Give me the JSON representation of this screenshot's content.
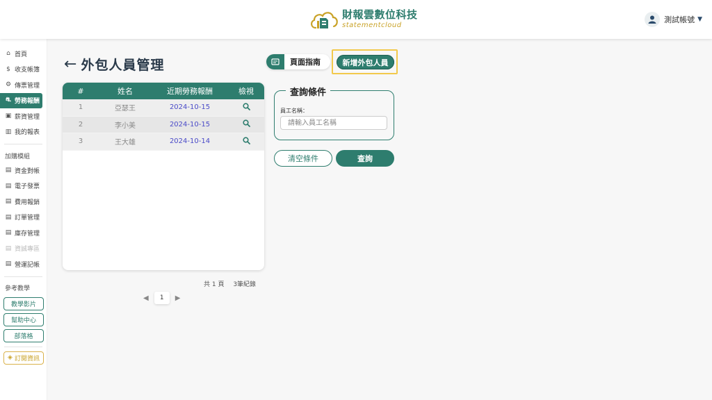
{
  "header": {
    "brand_cn": "財報雲數位科技",
    "brand_en": "statementcloud",
    "account_label": "測試帳號",
    "caret": "▼"
  },
  "sidebar": {
    "main_items": [
      {
        "label": "首頁",
        "icon": "home-icon",
        "glyph": "⌂"
      },
      {
        "label": "收支帳簿",
        "icon": "ledger-icon",
        "glyph": "$"
      },
      {
        "label": "傳票管理",
        "icon": "voucher-icon",
        "glyph": "⚙"
      },
      {
        "label": "勞務報酬",
        "icon": "labor-icon",
        "glyph": "⛐"
      },
      {
        "label": "薪資管理",
        "icon": "wallet-icon",
        "glyph": "▣"
      },
      {
        "label": "我的報表",
        "icon": "chart-icon",
        "glyph": "▥"
      }
    ],
    "addon_section_label": "加購模組",
    "addon_items": [
      {
        "label": "資金對帳",
        "icon": "doc-icon",
        "glyph": "▤"
      },
      {
        "label": "電子發票",
        "icon": "doc-icon",
        "glyph": "▤"
      },
      {
        "label": "費用報銷",
        "icon": "doc-icon",
        "glyph": "▤"
      },
      {
        "label": "訂單管理",
        "icon": "doc-icon",
        "glyph": "▤"
      },
      {
        "label": "庫存管理",
        "icon": "doc-icon",
        "glyph": "▤"
      },
      {
        "label": "資誠專區",
        "icon": "doc-icon",
        "glyph": "▤"
      },
      {
        "label": "營運記帳",
        "icon": "doc-icon",
        "glyph": "▤"
      }
    ],
    "reference_section_label": "參考教學",
    "reference_buttons": [
      "教學影片",
      "幫助中心",
      "部落格"
    ],
    "subscribe_label": "訂閱資訊",
    "subscribe_icon": "diamond-icon"
  },
  "page": {
    "back_arrow": "←",
    "title": "外包人員管理",
    "guide_label": "頁面指南",
    "guide_icon_glyph": "✉",
    "add_button_label": "新增外包人員"
  },
  "table": {
    "headers": [
      "#",
      "姓名",
      "近期勞務報酬",
      "檢視"
    ],
    "rows": [
      {
        "no": "1",
        "name": "亞瑟王",
        "date": "2024-10-15"
      },
      {
        "no": "2",
        "name": "李小美",
        "date": "2024-10-15"
      },
      {
        "no": "3",
        "name": "王大雄",
        "date": "2024-10-14"
      }
    ],
    "view_icon": "magnifier-icon"
  },
  "pagination": {
    "total_pages_text": "共 1 頁",
    "total_records_text": "3筆紀錄",
    "current_page": "1",
    "prev_glyph": "◀",
    "next_glyph": "▶"
  },
  "query": {
    "legend": "查詢條件",
    "field_label": "員工名稱：",
    "field_placeholder": "請輸入員工名稱",
    "field_value": "",
    "clear_label": "清空條件",
    "search_label": "查詢"
  },
  "colors": {
    "primary": "#2e7d6e",
    "accent_gold": "#c9a227",
    "highlight": "#f2c94c",
    "date_link": "#4a4ac8"
  }
}
